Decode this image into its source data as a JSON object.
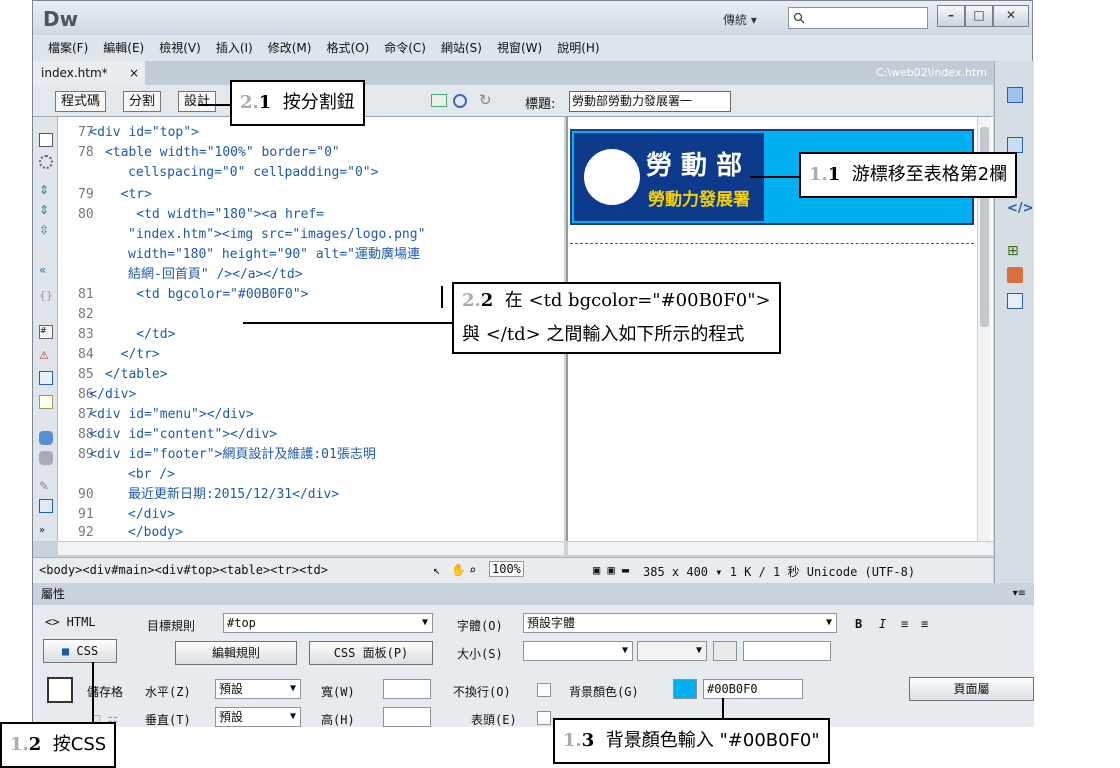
{
  "app": {
    "name": "Dw",
    "workspace": "傳統 ▾"
  },
  "menu": [
    "檔案(F)",
    "編輯(E)",
    "檢視(V)",
    "插入(I)",
    "修改(M)",
    "格式(O)",
    "命令(C)",
    "網站(S)",
    "視窗(W)",
    "說明(H)"
  ],
  "doc": {
    "tab": "index.htm*",
    "close": "×",
    "path": "C:\\web02\\index.htm"
  },
  "toolbar": {
    "code": "程式碼",
    "split": "分割",
    "design": "設計",
    "title_label": "標題:",
    "title_value": "勞動部勞動力發展署一"
  },
  "code_lines": [
    {
      "n": "77",
      "t": "    <div id=\"top\">"
    },
    {
      "n": "78",
      "t": "      <table width=\"100%\" border=\"0\""
    },
    {
      "n": "",
      "t": "cellspacing=\"0\" cellpadding=\"0\">"
    },
    {
      "n": "79",
      "t": "        <tr>"
    },
    {
      "n": "80",
      "t": "          <td width=\"180\"><a href="
    },
    {
      "n": "",
      "t": "\"index.htm\"><img src=\"images/logo.png\""
    },
    {
      "n": "",
      "t": "width=\"180\" height=\"90\" alt=\"運動廣場連"
    },
    {
      "n": "",
      "t": "結網-回首頁\" /></a></td>"
    },
    {
      "n": "81",
      "t": "          <td bgcolor=\"#00B0F0\">"
    },
    {
      "n": "82",
      "t": ""
    },
    {
      "n": "83",
      "t": "          </td>"
    },
    {
      "n": "84",
      "t": "        </tr>"
    },
    {
      "n": "85",
      "t": "      </table>"
    },
    {
      "n": "86",
      "t": "    </div>"
    },
    {
      "n": "87",
      "t": "    <div id=\"menu\"></div>"
    },
    {
      "n": "88",
      "t": "    <div id=\"content\"></div>"
    },
    {
      "n": "89",
      "t": "    <div id=\"footer\">網頁設計及維護:01張志明"
    },
    {
      "n": "",
      "t": "<br />"
    },
    {
      "n": "90",
      "t": "最近更新日期:2015/12/31</div>"
    },
    {
      "n": "91",
      "t": "</div>"
    },
    {
      "n": "92",
      "t": "</body>"
    }
  ],
  "design": {
    "logo_title": "勞 動 部",
    "logo_sub": "勞動力發展署"
  },
  "status": {
    "breadcrumb": "<body><div#main><div#top><table><tr><td>",
    "zoom": "100%",
    "info": "385 x 400 ▾ 1 K / 1 秒 Unicode (UTF-8)"
  },
  "props": {
    "header": "屬性",
    "html_btn": "<> HTML",
    "css_btn": "CSS",
    "target_rule_label": "目標規則",
    "target_rule_value": "#top",
    "edit_rule": "編輯規則",
    "css_panel": "CSS 面板(P)",
    "font_label": "字體(O)",
    "font_value": "預設字體",
    "size_label": "大小(S)",
    "bold": "B",
    "italic": "I",
    "cell_label": "儲存格",
    "horz_label": "水平(Z)",
    "horz_value": "預設",
    "width_label": "寬(W)",
    "nowrap_label": "不換行(O)",
    "bg_label": "背景顏色(G)",
    "bg_value": "#00B0F0",
    "page_props": "頁面屬",
    "vert_label": "垂直(T)",
    "vert_value": "預設",
    "height_label": "高(H)",
    "header_label": "表頭(E)"
  },
  "callouts": {
    "c21_num1": "2.",
    "c21_num2": "1",
    "c21_text": "按分割鈕",
    "c11_num1": "1.",
    "c11_num2": "1",
    "c11_text": "游標移至表格第2欄",
    "c22_num1": "2.",
    "c22_num2": "2",
    "c22_text1": "在 <td bgcolor=\"#00B0F0\">",
    "c22_text2": "與 </td> 之間輸入如下所示的程式",
    "c12_num1": "1.",
    "c12_num2": "2",
    "c12_text": "按CSS",
    "c13_num1": "1.",
    "c13_num2": "3",
    "c13_text": "背景顏色輸入 \"#00B0F0\""
  },
  "colors": {
    "cell_bg": "#00B0F0",
    "code_blue": "#1d5aaa"
  }
}
